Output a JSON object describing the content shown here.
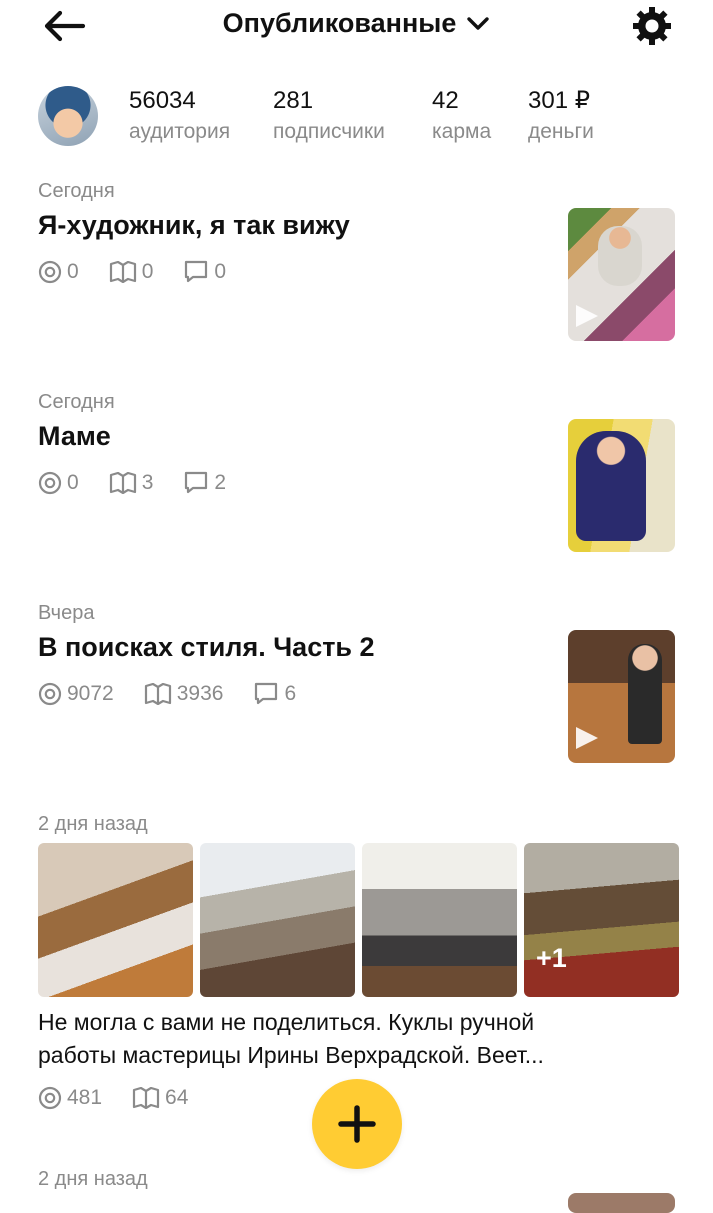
{
  "header": {
    "title": "Опубликованные",
    "back_icon": "arrow-left-icon",
    "dropdown_icon": "chevron-down-icon",
    "settings_icon": "gear-icon"
  },
  "profile": {
    "stats": [
      {
        "value": "56034",
        "label": "аудитория"
      },
      {
        "value": "281",
        "label": "подписчики"
      },
      {
        "value": "42",
        "label": "карма"
      },
      {
        "value": "301 ₽",
        "label": "деньги"
      }
    ]
  },
  "posts": [
    {
      "date": "Сегодня",
      "title": "Я-художник, я так вижу",
      "views": "0",
      "reads": "0",
      "comments": "0",
      "video": true
    },
    {
      "date": "Сегодня",
      "title": "Маме",
      "views": "0",
      "reads": "3",
      "comments": "2",
      "video": false
    },
    {
      "date": "Вчера",
      "title": "В поисках стиля. Часть 2",
      "views": "9072",
      "reads": "3936",
      "comments": "6",
      "video": true
    },
    {
      "date": "2 дня назад",
      "text_line1": "Не могла с вами не поделиться. Куклы ручной",
      "text_line2": "работы мастерицы Ирины Верхрадской. Веет...",
      "views": "481",
      "reads": "64",
      "extra_photos": "+1"
    },
    {
      "date": "2 дня назад"
    }
  ],
  "fab": {
    "icon": "plus-icon"
  },
  "colors": {
    "accent": "#ffcc33",
    "muted": "#8a8a8a",
    "text": "#111111"
  }
}
